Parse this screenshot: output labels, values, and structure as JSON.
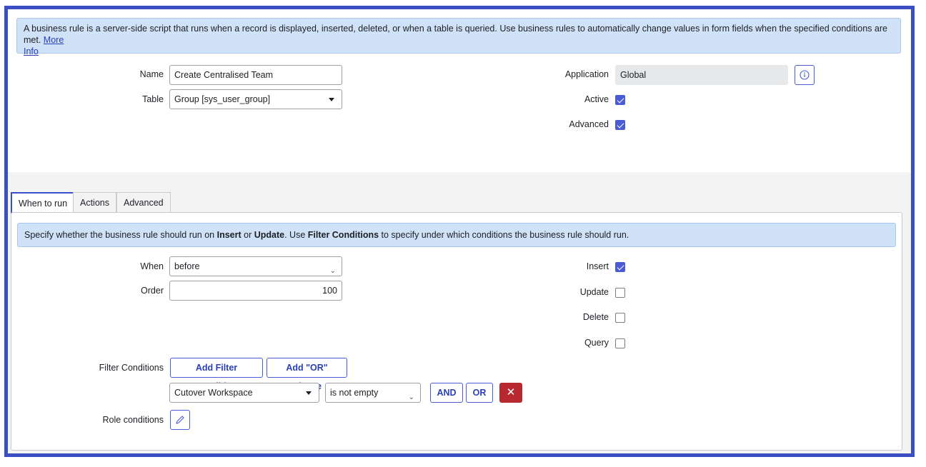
{
  "info_banner": {
    "text": "A business rule is a server-side script that runs when a record is displayed, inserted, deleted, or when a table is queried. Use business rules to automatically change values in form fields when the specified conditions are met.",
    "link_text_1": "More",
    "link_text_2": "Info"
  },
  "form": {
    "name_label": "Name",
    "name_value": "Create Centralised Team",
    "table_label": "Table",
    "table_value": "Group [sys_user_group]",
    "application_label": "Application",
    "application_value": "Global",
    "active_label": "Active",
    "active_checked": true,
    "advanced_label": "Advanced",
    "advanced_checked": true
  },
  "tabs": [
    {
      "label": "When to run",
      "active": true
    },
    {
      "label": "Actions",
      "active": false
    },
    {
      "label": "Advanced",
      "active": false
    }
  ],
  "when_to_run": {
    "banner": {
      "p1": "Specify whether the business rule should run on ",
      "b1": "Insert",
      "p2": " or ",
      "b2": "Update",
      "p3": ". Use ",
      "b3": "Filter Conditions",
      "p4": " to specify under which conditions the business rule should run."
    },
    "when_label": "When",
    "when_value": "before",
    "order_label": "Order",
    "order_value": "100",
    "insert_label": "Insert",
    "insert_checked": true,
    "update_label": "Update",
    "update_checked": false,
    "delete_label": "Delete",
    "delete_checked": false,
    "query_label": "Query",
    "query_checked": false,
    "filter_label": "Filter Conditions",
    "add_filter_label": "Add Filter Condition",
    "add_or_label": "Add \"OR\" Clause",
    "condition_field": "Cutover Workspace",
    "condition_operator": "is not empty",
    "and_label": "AND",
    "or_label": "OR",
    "delete_symbol": "✕",
    "role_label": "Role conditions"
  },
  "colors": {
    "accent": "#3b4fc4",
    "info_bg": "#cfe2f7",
    "delete": "#b8282f"
  }
}
